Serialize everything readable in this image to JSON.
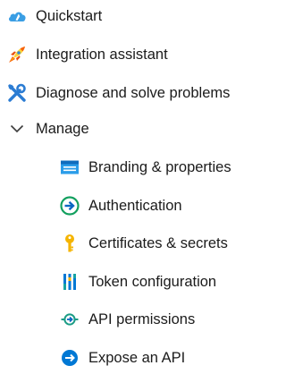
{
  "nav": {
    "quickstart": {
      "label": "Quickstart",
      "icon": "cloud-quickstart-icon"
    },
    "integration_assistant": {
      "label": "Integration assistant",
      "icon": "rocket-icon"
    },
    "diagnose": {
      "label": "Diagnose and solve problems",
      "icon": "wrench-icon"
    },
    "manage": {
      "label": "Manage",
      "icon": "chevron-down-icon",
      "expanded": true,
      "items": [
        {
          "label": "Branding & properties",
          "icon": "branding-icon"
        },
        {
          "label": "Authentication",
          "icon": "authentication-icon"
        },
        {
          "label": "Certificates & secrets",
          "icon": "key-icon"
        },
        {
          "label": "Token configuration",
          "icon": "token-configuration-icon"
        },
        {
          "label": "API permissions",
          "icon": "api-permissions-icon"
        },
        {
          "label": "Expose an API",
          "icon": "expose-api-icon"
        }
      ]
    }
  },
  "colors": {
    "text": "#1b1b1b",
    "azure_blue": "#0078d4",
    "teal": "#16a3a3",
    "green": "#1b9c85",
    "gold": "#f5b400",
    "orange": "#f7630c"
  }
}
